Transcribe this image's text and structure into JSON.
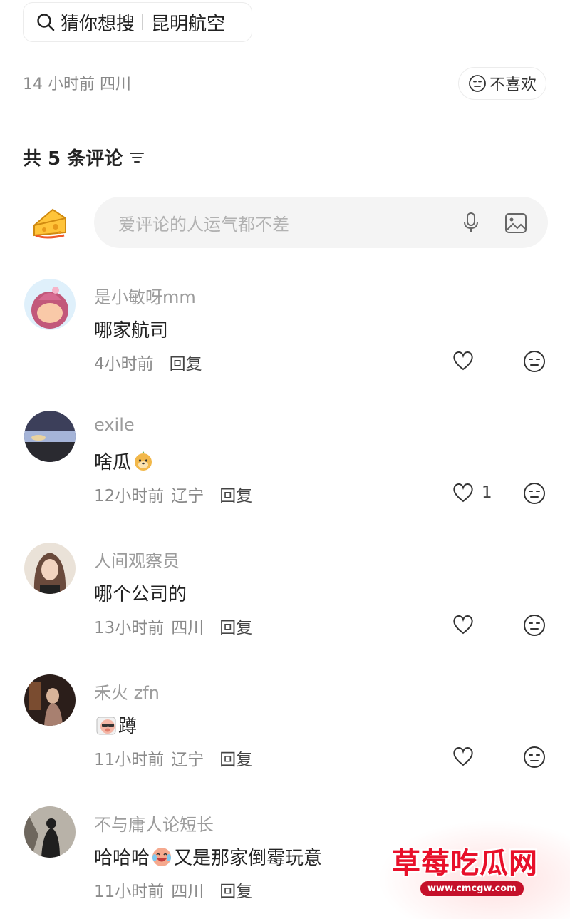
{
  "search": {
    "prefix": "猜你想搜",
    "query": "昆明航空"
  },
  "post_meta": {
    "time_location": "14 小时前 四川",
    "dislike_label": "不喜欢"
  },
  "comments_header": {
    "label": "共 5 条评论"
  },
  "input": {
    "placeholder": "爱评论的人运气都不差"
  },
  "comments": [
    {
      "name": "是小敏呀mm",
      "text": "哪家航司",
      "emoji": "",
      "text_after": "",
      "time": "4小时前",
      "location": "",
      "reply": "回复",
      "likes": "",
      "avatar_color": "#f6b3c8"
    },
    {
      "name": "exile",
      "text": "啥瓜",
      "emoji": "dog-emoji",
      "text_after": "",
      "time": "12小时前",
      "location": "辽宁",
      "reply": "回复",
      "likes": "1",
      "avatar_color": "#6a6f8a"
    },
    {
      "name": "人间观察员",
      "text": "哪个公司的",
      "emoji": "",
      "text_after": "",
      "time": "13小时前",
      "location": "四川",
      "reply": "回复",
      "likes": "",
      "avatar_color": "#5a4a42"
    },
    {
      "name": "禾火 zfn",
      "text": "",
      "emoji": "pig-emoji",
      "text_after": "蹲",
      "time": "11小时前",
      "location": "辽宁",
      "reply": "回复",
      "likes": "",
      "avatar_color": "#3a2a24"
    },
    {
      "name": "不与庸人论短长",
      "text": "哈哈哈",
      "emoji": "laugh-cry-emoji",
      "text_after": "又是那家倒霉玩意",
      "time": "11小时前",
      "location": "四川",
      "reply": "回复",
      "likes": "",
      "avatar_color": "#8a8278"
    }
  ],
  "watermark": {
    "title": "草莓吃瓜网",
    "url": "www.cmcgw.com"
  }
}
